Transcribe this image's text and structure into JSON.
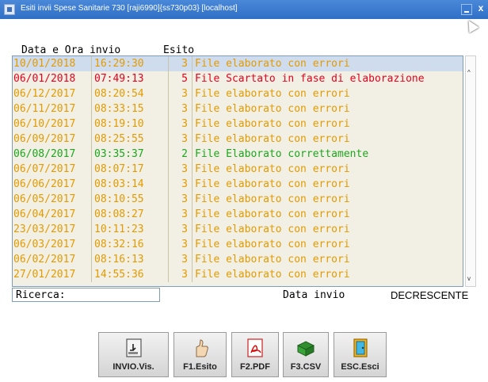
{
  "window": {
    "title": "Esiti invii Spese Sanitarie 730 [raji6990]{ss730p03} [localhost]",
    "close_glyph": "x"
  },
  "headers": {
    "datetime": "Data e Ora invio",
    "outcome": "Esito"
  },
  "colors": {
    "error": "#e39a00",
    "rejected": "#e8001c",
    "ok": "#1ea51e"
  },
  "rows": [
    {
      "date": "10/01/2018",
      "time": "16:29:30",
      "code": "3",
      "desc": "File elaborato con errori",
      "status": "error",
      "selected": true
    },
    {
      "date": "06/01/2018",
      "time": "07:49:13",
      "code": "5",
      "desc": "File Scartato in fase di elaborazione",
      "status": "rejected"
    },
    {
      "date": "06/12/2017",
      "time": "08:20:54",
      "code": "3",
      "desc": "File elaborato con errori",
      "status": "error"
    },
    {
      "date": "06/11/2017",
      "time": "08:33:15",
      "code": "3",
      "desc": "File elaborato con errori",
      "status": "error"
    },
    {
      "date": "06/10/2017",
      "time": "08:19:10",
      "code": "3",
      "desc": "File elaborato con errori",
      "status": "error"
    },
    {
      "date": "06/09/2017",
      "time": "08:25:55",
      "code": "3",
      "desc": "File elaborato con errori",
      "status": "error"
    },
    {
      "date": "06/08/2017",
      "time": "03:35:37",
      "code": "2",
      "desc": "File Elaborato correttamente",
      "status": "ok"
    },
    {
      "date": "06/07/2017",
      "time": "08:07:17",
      "code": "3",
      "desc": "File elaborato con errori",
      "status": "error"
    },
    {
      "date": "06/06/2017",
      "time": "08:03:14",
      "code": "3",
      "desc": "File elaborato con errori",
      "status": "error"
    },
    {
      "date": "06/05/2017",
      "time": "08:10:55",
      "code": "3",
      "desc": "File elaborato con errori",
      "status": "error"
    },
    {
      "date": "06/04/2017",
      "time": "08:08:27",
      "code": "3",
      "desc": "File elaborato con errori",
      "status": "error"
    },
    {
      "date": "23/03/2017",
      "time": "10:11:23",
      "code": "3",
      "desc": "File elaborato con errori",
      "status": "error"
    },
    {
      "date": "06/03/2017",
      "time": "08:32:16",
      "code": "3",
      "desc": "File elaborato con errori",
      "status": "error"
    },
    {
      "date": "06/02/2017",
      "time": "08:16:13",
      "code": "3",
      "desc": "File elaborato con errori",
      "status": "error"
    },
    {
      "date": "27/01/2017",
      "time": "14:55:36",
      "code": "3",
      "desc": "File elaborato con errori",
      "status": "error"
    }
  ],
  "scroll": {
    "up": "^",
    "down": "v"
  },
  "search": {
    "label": "Ricerca:",
    "value": ""
  },
  "sort": {
    "label": "Data invio",
    "direction": "DECRESCENTE"
  },
  "buttons": [
    {
      "label": "INVIO.Vis.",
      "icon": "document-import-icon"
    },
    {
      "label": "F1.Esito",
      "icon": "thumbs-up-icon"
    },
    {
      "label": "F2.PDF",
      "icon": "pdf-icon"
    },
    {
      "label": "F3.CSV",
      "icon": "spreadsheet-icon"
    },
    {
      "label": "ESC.Esci",
      "icon": "exit-door-icon"
    }
  ]
}
